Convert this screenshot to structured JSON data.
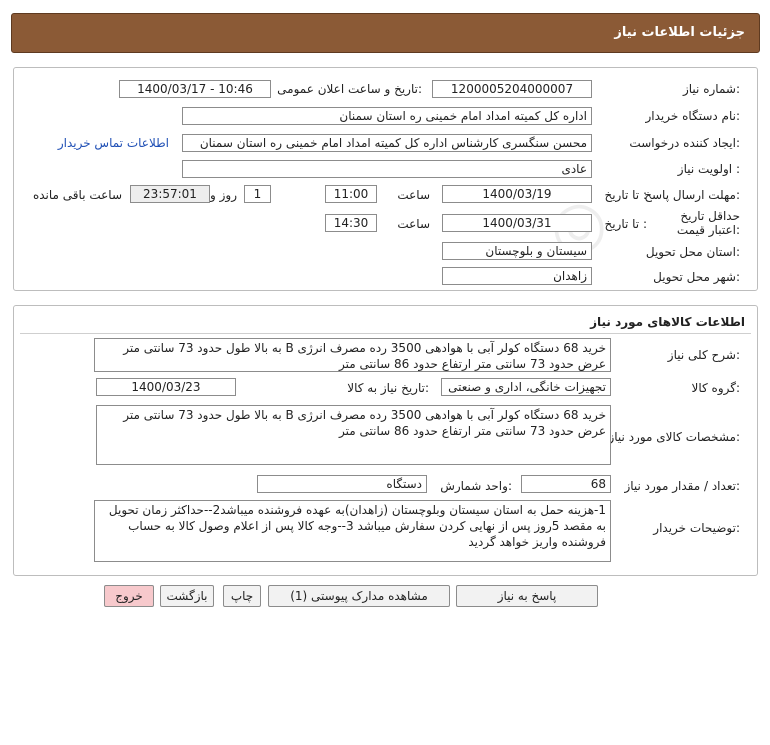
{
  "header": {
    "title": "جزئیات اطلاعات نیاز"
  },
  "need_info": {
    "need_number_label": "شماره نیاز:",
    "need_number": "1200005204000007",
    "announce_label": "تاریخ و ساعت اعلان عمومی:",
    "announce_value": "1400/03/17 - 10:46",
    "buyer_label": "نام دستگاه خریدار:",
    "buyer_value": "اداره کل کمیته امداد امام خمینی  ره  استان سمنان",
    "creator_label": "ایجاد کننده درخواست:",
    "creator_value": "محسن  سنگسری کارشناس اداره کل کمیته امداد امام خمینی  ره  استان سمنان",
    "contact_link": "اطلاعات تماس خریدار",
    "priority_label": "اولویت نیاز :",
    "priority_value": "عادی",
    "deadline_label": "مهلت ارسال پاسخ:",
    "until_date_label": "تا تاریخ :",
    "deadline_date": "1400/03/19",
    "time_label": "ساعت",
    "deadline_time": "11:00",
    "days_value": "1",
    "days_label": "روز و",
    "remaining_time": "23:57:01",
    "remaining_label": "ساعت باقی مانده",
    "validity_label": "حداقل تاریخ اعتبار قیمت:",
    "validity_date": "1400/03/31",
    "validity_time": "14:30",
    "province_label": "استان محل تحویل:",
    "province_value": "سیستان و بلوچستان",
    "city_label": "شهر محل تحویل:",
    "city_value": "زاهدان"
  },
  "goods": {
    "section_title": "اطلاعات کالاهای مورد نیاز",
    "summary_label": "شرح کلی نیاز:",
    "summary_value": "خرید 68 دستگاه کولر آبی با هوادهی 3500 رده مصرف انرژی B  به بالا طول حدود 73 سانتی متر عرض حدود 73 سانتی متر ارتفاع حدود 86 سانتی متر",
    "group_label": "گروه کالا:",
    "group_value": "تجهیزات خانگی، اداری و صنعتی",
    "need_date_label": "تاریخ نیاز به کالا:",
    "need_date_value": "1400/03/23",
    "spec_label": "مشخصات کالای مورد نیاز:",
    "spec_value": "خرید 68 دستگاه کولر آبی با هوادهی 3500 رده مصرف انرژی B  به بالا طول حدود 73 سانتی متر عرض حدود 73 سانتی متر ارتفاع حدود 86 سانتی متر",
    "qty_label": "تعداد / مقدار مورد نیاز:",
    "qty_value": "68",
    "unit_label": "واحد شمارش:",
    "unit_value": "دستگاه",
    "notes_label": "توضیحات خریدار:",
    "notes_value": "1-هزینه حمل به استان سیستان وبلوچستان (زاهدان)به عهده فروشنده میباشد2--حداکثر زمان تحویل به مقصد 5روز پس از نهایی کردن سفارش میباشد 3--وجه کالا پس از اعلام وصول کالا به حساب فروشنده واریز خواهد گردید"
  },
  "buttons": {
    "reply": "پاسخ به نیاز",
    "attachments": "مشاهده مدارک پیوستی (1)",
    "print": "چاپ",
    "back": "بازگشت",
    "exit": "خروج"
  }
}
